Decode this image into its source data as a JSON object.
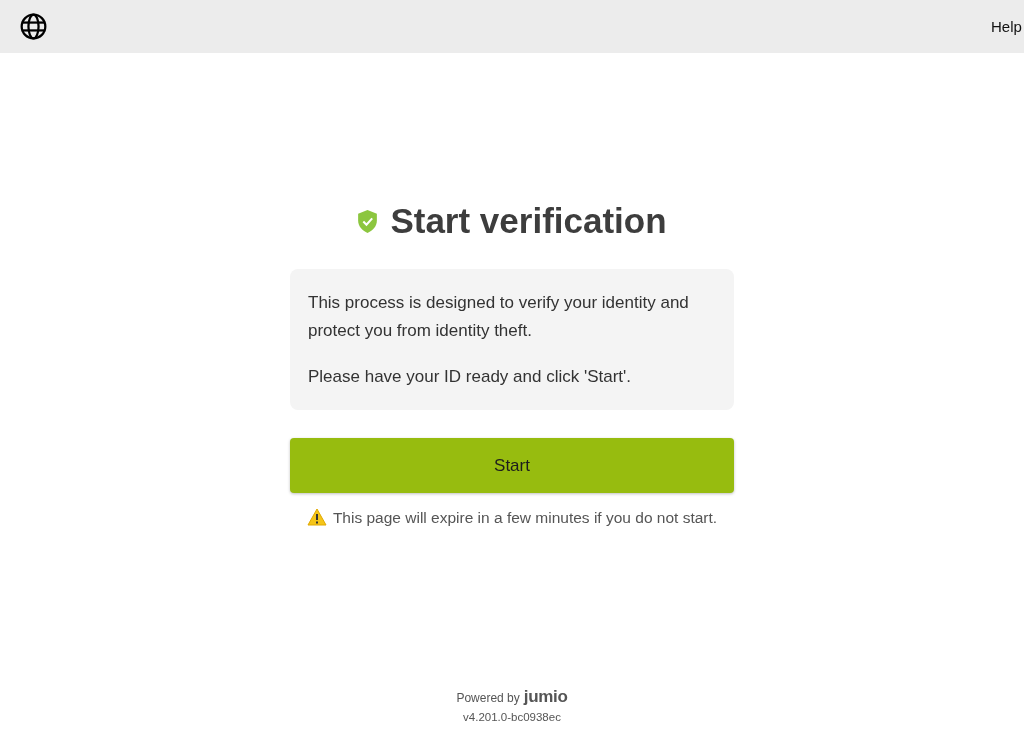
{
  "header": {
    "help_link": "Help"
  },
  "title": "Start verification",
  "info": [
    "This process is designed to verify your identity and protect you from identity theft.",
    "Please have your ID ready and click 'Start'."
  ],
  "start_button": "Start",
  "warning": "This page will expire in a few minutes if you do not start.",
  "footer": {
    "powered_by": "Powered by",
    "brand": "jumio",
    "version": "v4.201.0-bc0938ec"
  }
}
